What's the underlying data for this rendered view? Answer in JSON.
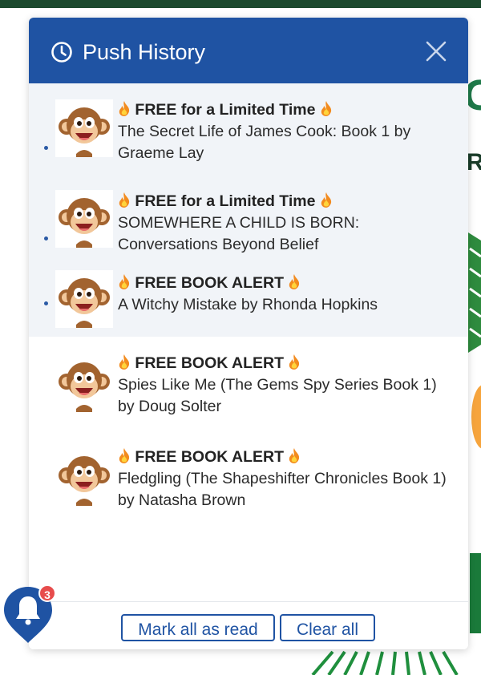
{
  "header": {
    "title": "Push History"
  },
  "notifications": [
    {
      "title": "FREE for a Limited Time",
      "body": "The Secret Life of James Cook: Book 1 by Graeme Lay",
      "unread": true
    },
    {
      "title": "FREE for a Limited Time",
      "body": "SOMEWHERE A CHILD IS BORN: Conversations Beyond Belief",
      "unread": true
    },
    {
      "title": "FREE BOOK ALERT",
      "body": "A Witchy Mistake by Rhonda Hopkins",
      "unread": true
    },
    {
      "title": "FREE BOOK ALERT",
      "body": "Spies Like Me (The Gems Spy Series Book 1) by Doug Solter",
      "unread": false
    },
    {
      "title": "FREE BOOK ALERT",
      "body": "Fledgling (The Shapeshifter Chronicles Book 1) by Natasha Brown",
      "unread": false
    }
  ],
  "footer": {
    "mark_all_label": "Mark all as read",
    "clear_all_label": "Clear all"
  },
  "bell": {
    "badge_count": "3"
  },
  "colors": {
    "header": "#1f53a3",
    "unread_bg": "#f1f4f8",
    "badge": "#e74c4c",
    "accent": "#1f53a3"
  }
}
